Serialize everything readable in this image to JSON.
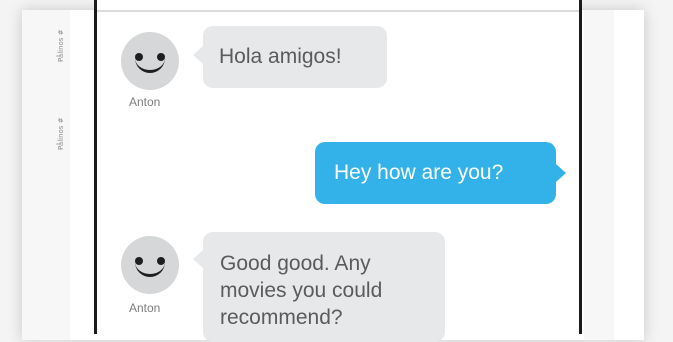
{
  "side_labels": [
    "Pålinos #",
    "Pålinos #"
  ],
  "messages": [
    {
      "sender": "Anton",
      "text": "Hola amigos!",
      "direction": "incoming"
    },
    {
      "sender": "",
      "text": "Hey how are you?",
      "direction": "outgoing"
    },
    {
      "sender": "Anton",
      "line1": "Good good. Any",
      "line2": "movies you could",
      "line3": "recommend?",
      "direction": "incoming"
    }
  ],
  "colors": {
    "incoming_bubble": "#e6e8e9",
    "outgoing_bubble": "#33b2ea",
    "avatar": "#d6d7d8",
    "device_frame": "#1b1b1b"
  },
  "icons": [
    "smiley-avatar-icon"
  ]
}
